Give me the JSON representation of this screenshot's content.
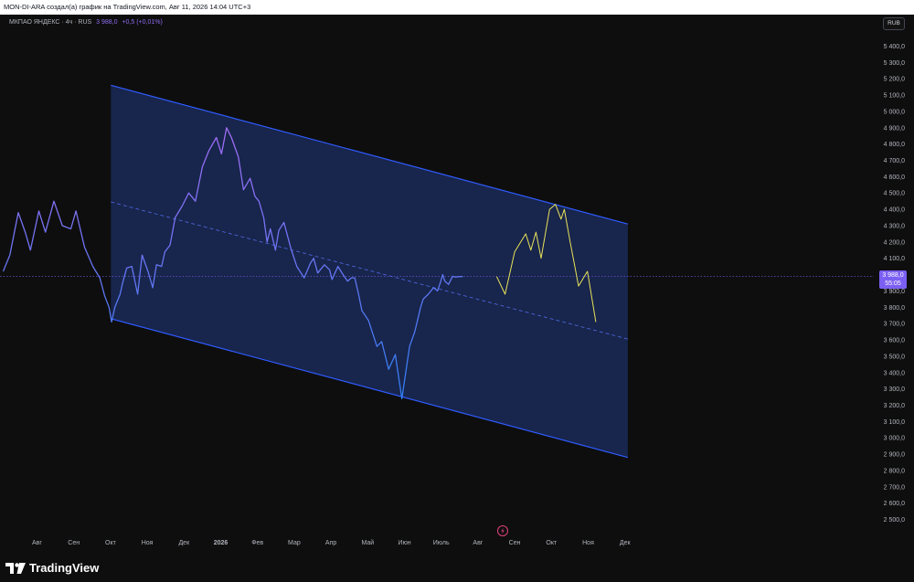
{
  "header": {
    "attribution": "MON-DI-ARA создал(а) график на TradingView.com, Авг 11, 2026 14:04 UTC+3"
  },
  "legend": {
    "symbol": "МКПАО ЯНДЕКС · 4ч · RUS",
    "price": "3 988,0",
    "change": "+0,5 (+0,01%)"
  },
  "currency_button": "RUB",
  "price_tag": {
    "price": "3 988,0",
    "countdown": "55:05"
  },
  "brand": {
    "name": "TradingView"
  },
  "colors": {
    "price_line_start": "#8f6cf0",
    "price_line_end": "#2f6df0",
    "forecast": "#e8e35a",
    "channel_line": "#2f5cff",
    "channel_fill": "#1a2957",
    "midline": "#4a64d8"
  },
  "chart_data": {
    "type": "line",
    "y_ticks": [
      "5 400,0",
      "5 300,0",
      "5 200,0",
      "5 100,0",
      "5 000,0",
      "4 900,0",
      "4 800,0",
      "4 700,0",
      "4 600,0",
      "4 500,0",
      "4 400,0",
      "4 300,0",
      "4 200,0",
      "4 100,0",
      "4 000,0",
      "3 900,0",
      "3 800,0",
      "3 700,0",
      "3 600,0",
      "3 500,0",
      "3 400,0",
      "3 300,0",
      "3 200,0",
      "3 100,0",
      "3 000,0",
      "2 900,0",
      "2 800,0",
      "2 700,0",
      "2 600,0",
      "2 500,0"
    ],
    "x_ticks": [
      "Авг",
      "Сен",
      "Окт",
      "Ноя",
      "Дек",
      "2026",
      "Фев",
      "Мар",
      "Апр",
      "Май",
      "Июн",
      "Июль",
      "Авг",
      "Сен",
      "Окт",
      "Ноя",
      "Дек"
    ],
    "ylim": [
      2450,
      5450
    ],
    "x_range": [
      0,
      16.96
    ],
    "price_series": {
      "x": [
        -0.92,
        -0.74,
        -0.51,
        -0.32,
        -0.18,
        0.05,
        0.23,
        0.46,
        0.69,
        0.92,
        1.06,
        1.29,
        1.52,
        1.71,
        1.84,
        1.96,
        2.03,
        2.12,
        2.26,
        2.33,
        2.44,
        2.58,
        2.74,
        2.86,
        3.02,
        3.15,
        3.25,
        3.39,
        3.48,
        3.62,
        3.76,
        3.95,
        4.13,
        4.31,
        4.5,
        4.68,
        4.88,
        5.02,
        5.16,
        5.29,
        5.48,
        5.62,
        5.8,
        5.93,
        6.04,
        6.17,
        6.26,
        6.35,
        6.49,
        6.58,
        6.72,
        6.91,
        7.07,
        7.27,
        7.44,
        7.53,
        7.64,
        7.82,
        7.96,
        8.03,
        8.19,
        8.33,
        8.45,
        8.56,
        8.65,
        8.75,
        8.84,
        9.02,
        9.25,
        9.38,
        9.57,
        9.75,
        9.93,
        10.14,
        10.28,
        10.44,
        10.51,
        10.65,
        10.79,
        10.9,
        10.99,
        11.04,
        11.1,
        11.2,
        11.31,
        11.38,
        11.5,
        11.59,
        11.68,
        11.79,
        11.88,
        11.98,
        12.09,
        12.14,
        12.2,
        12.31,
        12.4,
        12.51
      ],
      "y": [
        4020,
        4120,
        4380,
        4260,
        4150,
        4390,
        4260,
        4450,
        4300,
        4280,
        4390,
        4170,
        4050,
        3980,
        3870,
        3800,
        3710,
        3800,
        3880,
        3950,
        4040,
        4050,
        3880,
        4120,
        4020,
        3920,
        4060,
        4050,
        4140,
        4180,
        4350,
        4420,
        4500,
        4450,
        4660,
        4760,
        4840,
        4740,
        4900,
        4840,
        4720,
        4520,
        4590,
        4480,
        4450,
        4350,
        4200,
        4280,
        4150,
        4270,
        4320,
        4160,
        4050,
        3980,
        4070,
        4100,
        4010,
        4060,
        4030,
        3970,
        4050,
        4000,
        3960,
        3980,
        3980,
        3880,
        3780,
        3720,
        3560,
        3590,
        3420,
        3510,
        3240,
        3560,
        3650,
        3800,
        3850,
        3880,
        3920,
        3900,
        3960,
        4000,
        3960,
        3940,
        3990,
        3985,
        3988,
        3988
      ],
      "names": {
        "start": "",
        "end": ""
      }
    },
    "forecast_series": {
      "x": [
        12.51,
        12.74,
        13.0,
        13.3,
        13.44,
        13.58,
        13.72,
        13.95,
        14.11,
        14.26,
        14.35,
        14.51,
        14.74,
        14.98,
        15.21
      ],
      "y": [
        3988,
        3880,
        4140,
        4250,
        4150,
        4260,
        4100,
        4400,
        4430,
        4340,
        4400,
        4200,
        3930,
        4020,
        3710
      ]
    },
    "channel": {
      "upper": {
        "x": [
          2.01,
          16.08
        ],
        "y": [
          5160,
          4310
        ]
      },
      "lower": {
        "x": [
          2.01,
          16.08
        ],
        "y": [
          3730,
          2880
        ]
      },
      "mid": {
        "x": [
          2.01,
          16.08
        ],
        "y": [
          4445,
          3605
        ]
      }
    },
    "current_price": 3988,
    "grid": false
  }
}
